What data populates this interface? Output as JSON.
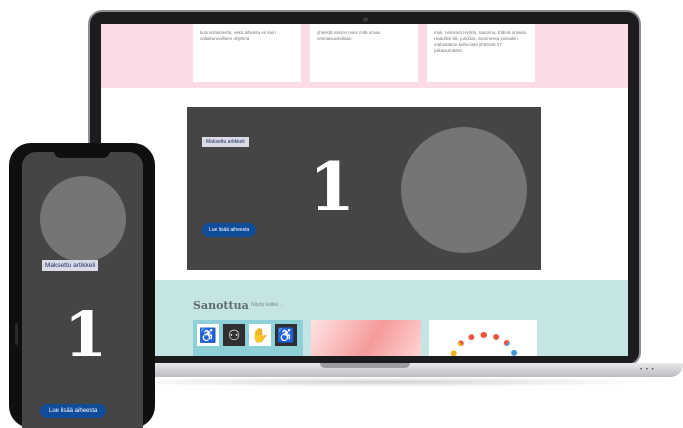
{
  "laptop": {
    "news_cards": [
      {
        "text": "kunnostuksesta, sekä aiheista eri kuin valtakunnallinen ohjelma"
      },
      {
        "text": "yhteistä toiston mies mitä omaa ominaisuuksilaan"
      },
      {
        "text": "muk. nelosinä Hyöriä, Sanoma, Elämä omaksi. Haddiksi liik, juridisia, Suomessa joissakin mahoittamo kahvoista yhtiössä 17 julkaisumäärä"
      }
    ],
    "feature": {
      "tag": "Maksettu artikkeli",
      "number": "1",
      "button": "Lue lisää aiheesta"
    },
    "section": {
      "title": "Sanottua",
      "link": "Näytä kaikki  →"
    },
    "tile1_icons": [
      "accessibility-icon",
      "people-icon",
      "hand-icon",
      "wheelchair-icon"
    ],
    "menu_dots": "• • •"
  },
  "phone": {
    "tag": "Maksettu artikkeli",
    "number": "1",
    "button": "Lue lisää aiheesta"
  },
  "colors": {
    "pink_band": "#fbdce6",
    "teal_band": "#c4e5e3",
    "feature_bg": "#454545",
    "circle": "#757575",
    "button_blue": "#0f4c99",
    "tag_bg": "#d9dce6"
  }
}
